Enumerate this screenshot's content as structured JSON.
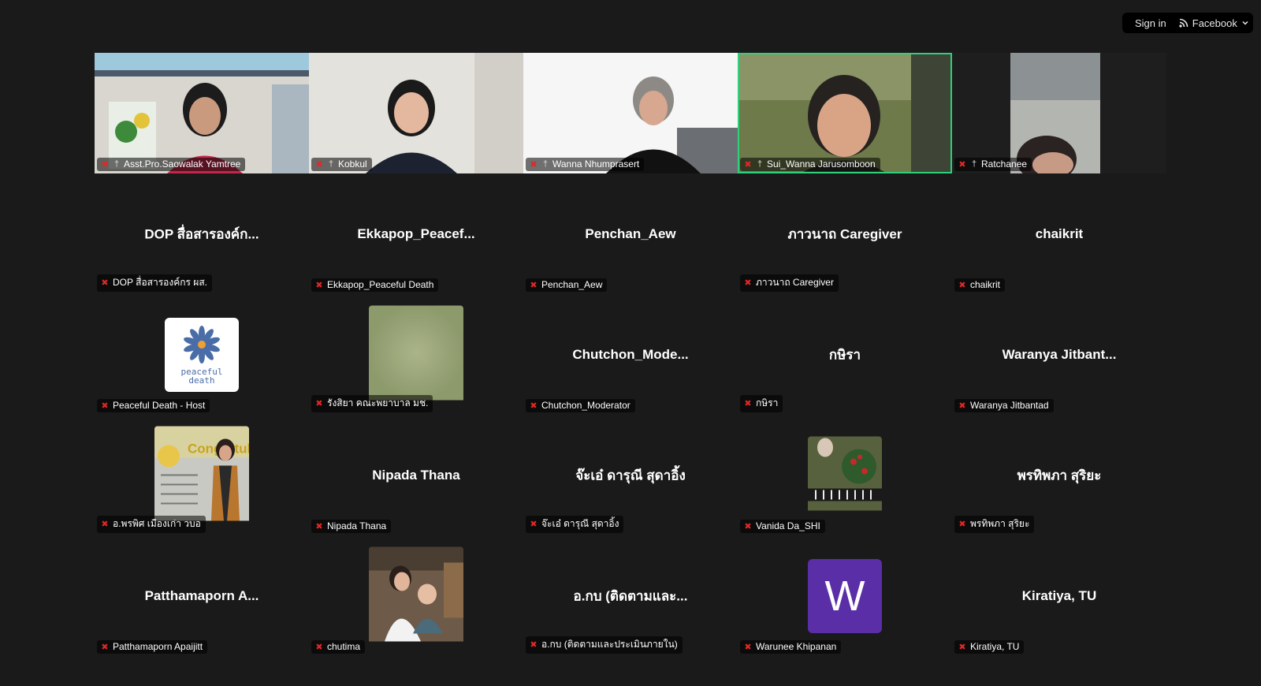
{
  "topbar": {
    "signin_label": "Sign in",
    "source_label": "Facebook"
  },
  "colors": {
    "background": "#1a1a1a",
    "active_speaker_border": "#2fd07a",
    "mic_off": "#e02828",
    "peaceful_death_blue": "#4a6da8",
    "w_avatar": "#5a2ea6"
  },
  "participants": [
    {
      "label": "Asst.Pro.Saowalak Yamtree",
      "video": true,
      "pinned": true
    },
    {
      "label": "Kobkul",
      "video": true,
      "pinned": true
    },
    {
      "label": "Wanna Nhumprasert",
      "video": true,
      "pinned": true
    },
    {
      "label": "Sui_Wanna Jarusomboon",
      "video": true,
      "pinned": true,
      "active_speaker": true
    },
    {
      "label": "Ratchanee",
      "video": true,
      "pinned": true
    },
    {
      "display": "DOP สื่อสารองค์ก...",
      "label": "DOP สื่อสารองค์กร ผส."
    },
    {
      "display": "Ekkapop_Peacef...",
      "label": "Ekkapop_Peaceful Death"
    },
    {
      "display": "Penchan_Aew",
      "label": "Penchan_Aew"
    },
    {
      "display": "ภาวนาถ Caregiver",
      "label": "ภาวนาถ Caregiver"
    },
    {
      "display": "chaikrit",
      "label": "chaikrit"
    },
    {
      "label": "Peaceful Death - Host",
      "avatar": "peaceful-death-logo",
      "logo_text_1": "peaceful",
      "logo_text_2": "death"
    },
    {
      "label": "รังสิยา คณะพยาบาล มช.",
      "avatar": "green-photo"
    },
    {
      "display": "Chutchon_Mode...",
      "label": "Chutchon_Moderator"
    },
    {
      "display": "กษิรา",
      "label": "กษิรา"
    },
    {
      "display": "Waranya Jitbant...",
      "label": "Waranya Jitbantad"
    },
    {
      "label": "อ.พรพิศ เมืองเก่า วบอ",
      "avatar": "graduation-photo",
      "photo_text": "Congratul"
    },
    {
      "display": "Nipada Thana",
      "label": "Nipada Thana"
    },
    {
      "display": "จ๊ะเอ๋ ดารุณี สุดาอิ้ง",
      "label": "จ๊ะเอ๋ ดารุณี สุดาอิ้ง"
    },
    {
      "label": "Vanida Da_SHI",
      "avatar": "piano-photo"
    },
    {
      "display": "พรทิพภา สุริยะ",
      "label": "พรทิพภา สุริยะ"
    },
    {
      "display": "Patthamaporn A...",
      "label": "Patthamaporn Apaijitt"
    },
    {
      "label": "chutima",
      "avatar": "family-photo"
    },
    {
      "display": "อ.กบ (ติดตามและ...",
      "label": "อ.กบ (ติดตามและประเมินภายใน)"
    },
    {
      "label": "Warunee Khipanan",
      "avatar": "letter",
      "letter": "W"
    },
    {
      "display": "Kiratiya, TU",
      "label": "Kiratiya, TU"
    }
  ]
}
